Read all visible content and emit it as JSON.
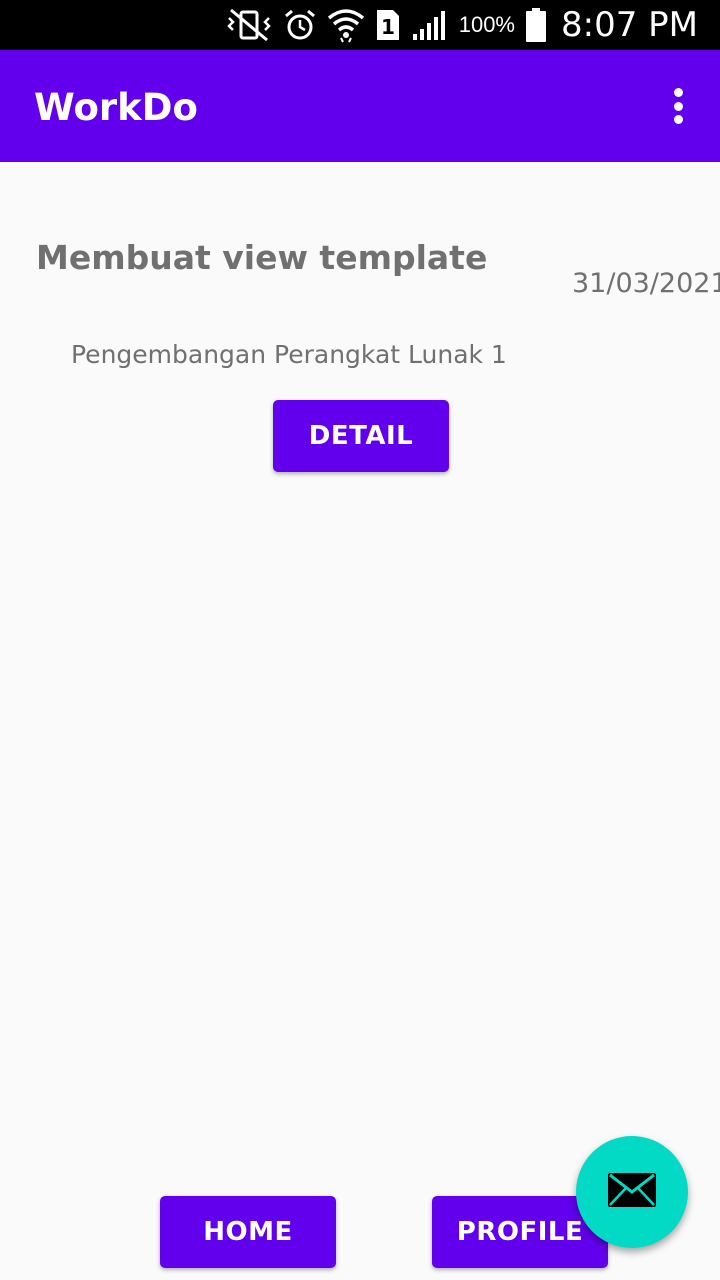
{
  "status_bar": {
    "battery_percent": "100%",
    "time": "8:07 PM",
    "sim_slot": "1",
    "icons": [
      "vibrate-mute-icon",
      "alarm-icon",
      "wifi-icon",
      "sim-icon",
      "signal-icon",
      "battery-icon"
    ]
  },
  "app_bar": {
    "title": "WorkDo",
    "menu_icon": "more-vert-icon"
  },
  "task": {
    "title": "Membuat view template",
    "date": "31/03/2021",
    "subject": "Pengembangan Perangkat Lunak 1",
    "detail_label": "DETAIL"
  },
  "bottom_nav": {
    "home_label": "HOME",
    "profile_label": "PROFILE"
  },
  "fab": {
    "icon": "mail-icon"
  },
  "colors": {
    "primary": "#6200ee",
    "accent": "#03dac5",
    "text_secondary": "#707070",
    "background": "#fafafa"
  }
}
